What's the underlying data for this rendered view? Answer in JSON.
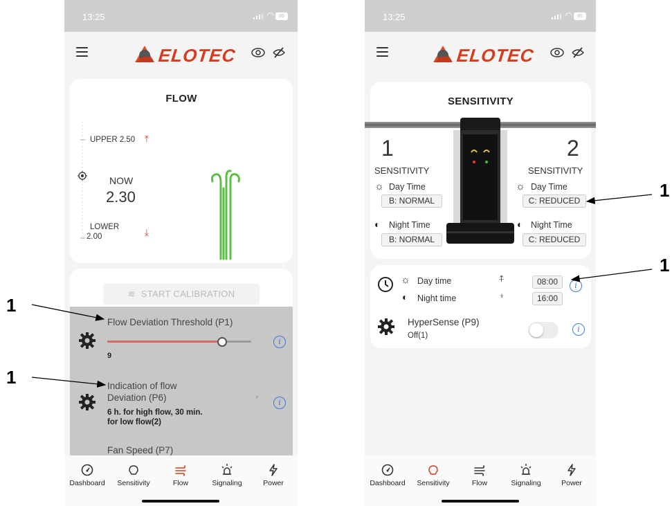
{
  "status_bar": {
    "time": "13:25",
    "battery": "85"
  },
  "app": {
    "brand": "ELOTEC"
  },
  "flow_screen": {
    "title": "FLOW",
    "upper_label": "UPPER 2.50",
    "now_label": "NOW",
    "now_value": "2.30",
    "lower_label": "LOWER",
    "lower_value": "2.00",
    "calibration_button": "START CALIBRATION",
    "settings": [
      {
        "label": "Flow Deviation Threshold (P1)",
        "value": "9",
        "slider_fraction": 0.8
      },
      {
        "label_line1": "Indication of flow",
        "label_line2": "Deviation (P6)",
        "value_line1": "6 h. for high flow, 30 min.",
        "value_line2": "for low flow(2)"
      },
      {
        "label": "Fan Speed (P7)"
      }
    ]
  },
  "sensitivity_screen": {
    "title": "SENSITIVITY",
    "sensors": [
      {
        "number": "1",
        "label": "SENSITIVITY",
        "day_label": "Day Time",
        "day_value": "B: NORMAL",
        "night_label": "Night Time",
        "night_value": "B: NORMAL"
      },
      {
        "number": "2",
        "label": "SENSITIVITY",
        "day_label": "Day Time",
        "day_value": "C: REDUCED",
        "night_label": "Night Time",
        "night_value": "C: REDUCED"
      }
    ],
    "schedule": {
      "day_label": "Day time",
      "day_time": "08:00",
      "night_label": "Night time",
      "night_time": "16:00"
    },
    "hypersense": {
      "label": "HyperSense (P9)",
      "status": "Off(1)",
      "enabled": false
    }
  },
  "nav": [
    "Dashboard",
    "Sensitivity",
    "Flow",
    "Signaling",
    "Power"
  ],
  "callout": "1",
  "colors": {
    "accent": "#d63b1f",
    "flow_green": "#5cbf45",
    "info_blue": "#3b7dd8",
    "slider_red": "#d46a6a"
  }
}
